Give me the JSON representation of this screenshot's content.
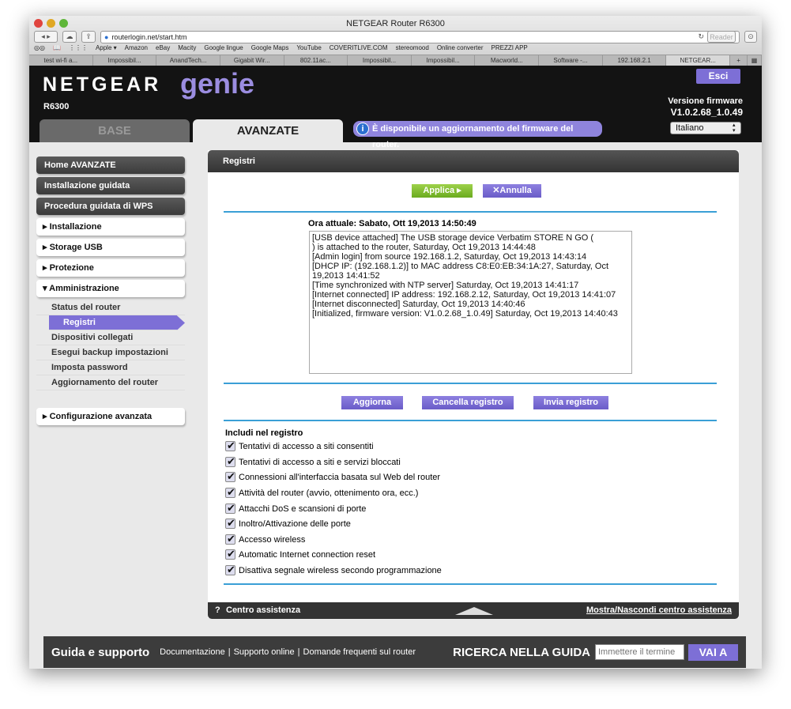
{
  "browser": {
    "title": "NETGEAR Router R6300",
    "url": "routerlogin.net/start.htm",
    "reader": "Reader",
    "bookmarks": [
      "Apple ▾",
      "Amazon",
      "eBay",
      "Macity",
      "Google lingue",
      "Google Maps",
      "YouTube",
      "COVERITLIVE.COM",
      "stereomood",
      "Online converter",
      "PREZZI APP"
    ],
    "tabs": [
      "test wi-fi a...",
      "Impossibil...",
      "AnandTech...",
      "Gigabit Wir...",
      "802.11ac...",
      "Impossibil...",
      "Impossibil...",
      "Macworld...",
      "Software -...",
      "192.168.2.1",
      "NETGEAR..."
    ]
  },
  "header": {
    "brand": "NETGEAR",
    "genie": "genie",
    "model": "R6300",
    "logout": "Esci",
    "fw_label": "Versione firmware",
    "fw_version": "V1.0.2.68_1.0.49",
    "tab_base": "BASE",
    "tab_advanced": "AVANZATE",
    "update_notice": "È disponibile un aggiornamento del firmware del router.",
    "language": "Italiano"
  },
  "sidebar": {
    "home": "Home AVANZATE",
    "setup_wizard": "Installazione guidata",
    "wps": "Procedura guidata di WPS",
    "setup": "Installazione",
    "usb": "Storage USB",
    "security": "Protezione",
    "admin": "Amministrazione",
    "admin_items": [
      "Status del router",
      "Registri",
      "Dispositivi collegati",
      "Esegui backup impostazioni",
      "Imposta password",
      "Aggiornamento del router"
    ],
    "advanced_setup": "Configurazione avanzata"
  },
  "panel": {
    "title": "Registri",
    "apply": "Applica ▸",
    "cancel": "✕Annulla",
    "now": "Ora attuale: Sabato, Ott 19,2013 14:50:49",
    "log": "[USB device attached] The USB storage device Verbatim STORE N GO (\n) is attached to the router, Saturday, Oct 19,2013 14:44:48\n[Admin login] from source 192.168.1.2, Saturday, Oct 19,2013 14:43:14\n[DHCP IP: (192.168.1.2)] to MAC address C8:E0:EB:34:1A:27, Saturday, Oct 19,2013 14:41:52\n[Time synchronized with NTP server] Saturday, Oct 19,2013 14:41:17\n[Internet connected] IP address: 192.168.2.12, Saturday, Oct 19,2013 14:41:07\n[Internet disconnected] Saturday, Oct 19,2013 14:40:46\n[Initialized, firmware version: V1.0.2.68_1.0.49] Saturday, Oct 19,2013 14:40:43",
    "refresh": "Aggiorna",
    "clear": "Cancella registro",
    "send": "Invia registro",
    "include_label": "Includi nel registro",
    "options": [
      "Tentativi di accesso a siti consentiti",
      "Tentativi di accesso a siti e servizi bloccati",
      "Connessioni all'interfaccia basata sul Web del router",
      "Attività del router (avvio, ottenimento ora, ecc.)",
      "Attacchi DoS e scansioni di porte",
      "Inoltro/Attivazione delle porte",
      "Accesso wireless",
      "Automatic Internet connection reset",
      "Disattiva segnale wireless secondo programmazione"
    ],
    "help_center": "Centro assistenza",
    "toggle_help": "Mostra/Nascondi centro assistenza"
  },
  "footer": {
    "title": "Guida e supporto",
    "links": [
      "Documentazione",
      "Supporto online",
      "Domande frequenti sul router"
    ],
    "search_title": "RICERCA NELLA GUIDA",
    "search_placeholder": "Immettere il termine",
    "go": "VAI A"
  }
}
